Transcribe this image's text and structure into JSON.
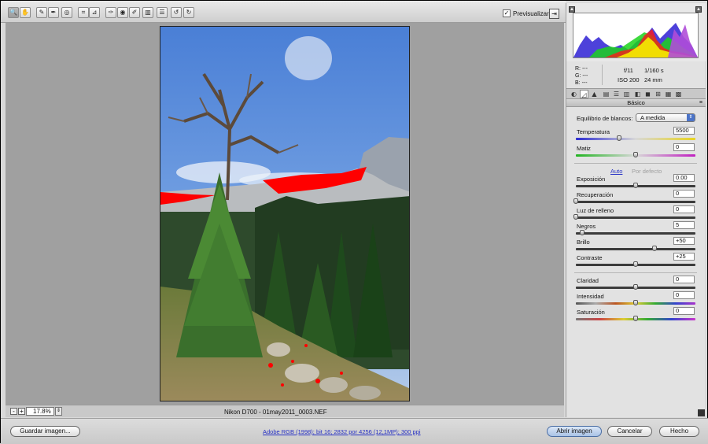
{
  "toolbar": {
    "tools": [
      {
        "icon": "zoom-icon",
        "glyph": "🔍"
      },
      {
        "icon": "hand-icon",
        "glyph": "✋"
      },
      {
        "icon": "white-balance-icon",
        "glyph": "✎"
      },
      {
        "icon": "color-sampler-icon",
        "glyph": "✒"
      },
      {
        "icon": "targeted-adjust-icon",
        "glyph": "◎"
      },
      {
        "icon": "crop-icon",
        "glyph": "⌗"
      },
      {
        "icon": "straighten-icon",
        "glyph": "⊿"
      },
      {
        "icon": "spot-removal-icon",
        "glyph": "✑"
      },
      {
        "icon": "red-eye-icon",
        "glyph": "◉"
      },
      {
        "icon": "adjustment-brush-icon",
        "glyph": "✐"
      },
      {
        "icon": "graduated-filter-icon",
        "glyph": "▥"
      },
      {
        "icon": "preferences-icon",
        "glyph": "☰"
      },
      {
        "icon": "rotate-left-icon",
        "glyph": "↺"
      },
      {
        "icon": "rotate-right-icon",
        "glyph": "↻"
      }
    ],
    "preview_label": "Previsualizar",
    "preview_checked": true
  },
  "status": {
    "zoom": "17.8%",
    "filename": "Nikon D700 -  01may2011_0003.NEF"
  },
  "readout": {
    "r_label": "R:",
    "r_value": "---",
    "g_label": "G:",
    "g_value": "---",
    "b_label": "B:",
    "b_value": "---",
    "aperture": "f/11",
    "shutter": "1/160 s",
    "iso": "ISO 200",
    "focal": "24 mm"
  },
  "panel": {
    "section_title": "Básico",
    "wb_label": "Equilibrio de blancos:",
    "wb_value": "A medida",
    "auto_label": "Auto",
    "default_label": "Por defecto",
    "sliders": [
      {
        "label": "Temperatura",
        "value": "5500",
        "pos": 0.36
      },
      {
        "label": "Matiz",
        "value": "0",
        "pos": 0.5
      },
      {
        "label": "Exposición",
        "value": "0.00",
        "pos": 0.5
      },
      {
        "label": "Recuperación",
        "value": "0",
        "pos": 0.0
      },
      {
        "label": "Luz de relleno",
        "value": "0",
        "pos": 0.0
      },
      {
        "label": "Negros",
        "value": "5",
        "pos": 0.05
      },
      {
        "label": "Brillo",
        "value": "+50",
        "pos": 0.66
      },
      {
        "label": "Contraste",
        "value": "+25",
        "pos": 0.5
      },
      {
        "label": "Claridad",
        "value": "0",
        "pos": 0.5
      },
      {
        "label": "Intensidad",
        "value": "0",
        "pos": 0.5
      },
      {
        "label": "Saturación",
        "value": "0",
        "pos": 0.5
      }
    ]
  },
  "bottom": {
    "save_label": "Guardar imagen...",
    "info_link": "Adobe RGB (1998); bit 16; 2832 por 4256 (12,1MP); 300 ppi",
    "open_label": "Abrir imagen",
    "cancel_label": "Cancelar",
    "done_label": "Hecho"
  },
  "colors": {
    "accent_blue": "#4c74c8",
    "clipping_red": "#ff0000",
    "link": "#2630c4"
  }
}
